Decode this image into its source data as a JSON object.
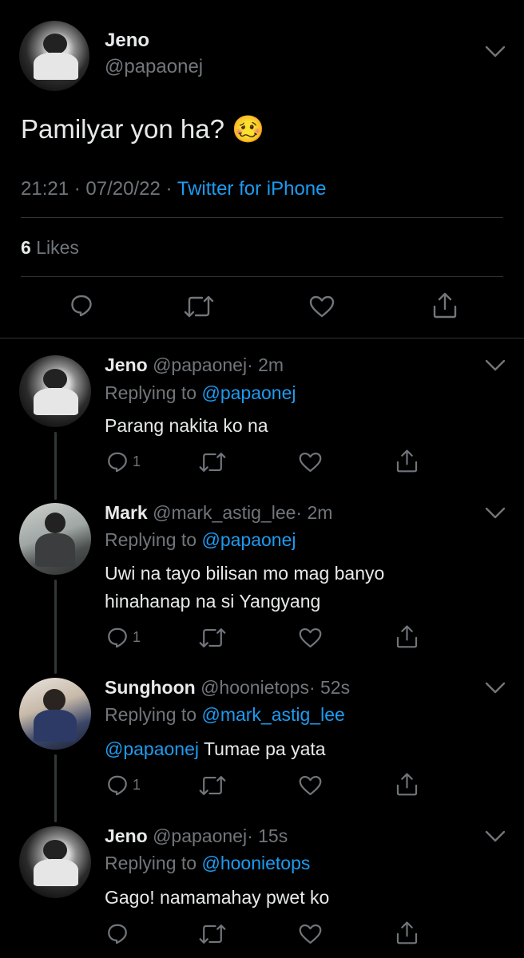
{
  "main_tweet": {
    "author_name": "Jeno",
    "author_handle": "@papaonej",
    "text": "Pamilyar yon ha? 🥴",
    "time": "21:21",
    "sep1": "·",
    "date": "07/20/22",
    "sep2": "·",
    "source": "Twitter for iPhone",
    "likes_count": "6",
    "likes_label": "Likes"
  },
  "replies": [
    {
      "name": "Jeno",
      "handle": "@papaonej",
      "age": "· 2m",
      "replying_prefix": "Replying to",
      "replying_to": "@papaonej",
      "text_line1": "Parang nakita ko na",
      "reply_count": "1"
    },
    {
      "name": "Mark",
      "handle": "@mark_astig_lee",
      "age": "· 2m",
      "replying_prefix": "Replying to",
      "replying_to": "@papaonej",
      "text_line1": "Uwi na tayo bilisan mo mag banyo",
      "text_line2": "hinahanap na si Yangyang",
      "reply_count": "1"
    },
    {
      "name": "Sunghoon",
      "handle": "@hoonietops",
      "age": "· 52s",
      "replying_prefix": "Replying to",
      "replying_to": "@mark_astig_lee",
      "mention": "@papaonej",
      "text_line1": "Tumae pa yata",
      "reply_count": "1"
    },
    {
      "name": "Jeno",
      "handle": "@papaonej",
      "age": "· 15s",
      "replying_prefix": "Replying to",
      "replying_to": "@hoonietops",
      "text_line1": "Gago! namamahay pwet ko"
    }
  ]
}
